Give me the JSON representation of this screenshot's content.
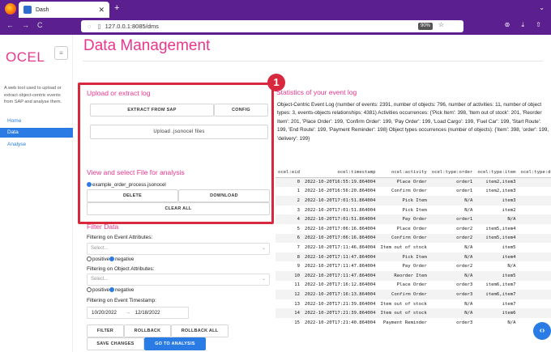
{
  "browser": {
    "tab_title": "Dash",
    "tab_close": "✕",
    "new_tab": "+",
    "tab_list": "⌄",
    "url": "127.0.0.1:8085/dms",
    "zoom": "90%",
    "back": "←",
    "forward": "→",
    "reload": "C",
    "toolbar_icons": "⊚ ⤓ ⇧"
  },
  "sidebar": {
    "brand": "OCEL",
    "menu_icon": "≡",
    "description": "A web tool used to upload or extract object-centric events from SAP and analyse them.",
    "items": [
      {
        "label": "Home"
      },
      {
        "label": "Data"
      },
      {
        "label": "Analyse"
      }
    ]
  },
  "main": {
    "title": "Data Management",
    "upload": {
      "title": "Upload or extract log",
      "extract_btn": "EXTRACT FROM SAP",
      "config_btn": "CONFIG",
      "upload_btn": "Upload .jsonocel files"
    },
    "view": {
      "title": "View and select File for analysis",
      "file": "example_order_process.jsonocel",
      "delete_btn": "DELETE",
      "download_btn": "DOWNLOAD",
      "clear_btn": "CLEAR ALL"
    },
    "annotation_number": "1",
    "filter": {
      "title": "Filter Data",
      "event_attr_label": "Filtering on Event Attributes:",
      "event_attr_placeholder": "Select...",
      "object_attr_label": "Filtering on Object Attributes:",
      "object_attr_placeholder": "Select...",
      "positive": "positive",
      "negative": "negative",
      "timestamp_label": "Filtering on Event Timestamp:",
      "date_from": "10/20/2022",
      "date_arrow": "→",
      "date_to": "12/18/2022",
      "filter_btn": "FILTER",
      "rollback_btn": "ROLLBACK",
      "rollback_all_btn": "ROLLBACK ALL",
      "save_btn": "SAVE CHANGES",
      "goto_btn": "GO TO ANALYSIS"
    },
    "stats": {
      "title": "Statistics of your event log",
      "text": "Object-Centric Event Log (number of events: 2391, number of objects: 796, number of activities: 11, number of object types: 3, events-objects relationships: 4381) Activities occurrences: {'Pick Item': 398, 'Item out of stock': 201, 'Reorder Item': 201, 'Place Order': 199, 'Confirm Order': 199, 'Pay Order': 199, 'Load Cargo': 199, 'Fuel Car': 199, 'Start Route': 199, 'End Route': 199, 'Payment Reminder': 198} Object types occurrences (number of objects): {'item': 398, 'order': 199, 'delivery': 199}"
    },
    "table": {
      "headers": [
        "ocel:eid",
        "ocel:timestamp",
        "ocel:activity",
        "ocel:type:order",
        "ocel:type:item",
        "ocel:type:delivery"
      ],
      "rows": [
        [
          "0",
          "2022-10-20T16:55:19.864004",
          "Place Order",
          "order1",
          "item2,item3",
          "N/"
        ],
        [
          "1",
          "2022-10-20T16:56:20.864004",
          "Confirm Order",
          "order1",
          "item2,item3",
          "N/"
        ],
        [
          "2",
          "2022-10-20T17:01:51.864004",
          "Pick Item",
          "N/A",
          "item3",
          "N/"
        ],
        [
          "3",
          "2022-10-20T17:01:51.864004",
          "Pick Item",
          "N/A",
          "item2",
          "N/"
        ],
        [
          "4",
          "2022-10-20T17:01:51.864004",
          "Pay Order",
          "order1",
          "N/A",
          "N/"
        ],
        [
          "5",
          "2022-10-20T17:06:16.864004",
          "Place Order",
          "order2",
          "item5,item4",
          "N/"
        ],
        [
          "6",
          "2022-10-20T17:06:16.864004",
          "Confirm Order",
          "order2",
          "item5,item4",
          "N/"
        ],
        [
          "7",
          "2022-10-20T17:11:46.864004",
          "Item out of stock",
          "N/A",
          "item5",
          "N/"
        ],
        [
          "8",
          "2022-10-20T17:11:47.864004",
          "Pick Item",
          "N/A",
          "item4",
          "N/"
        ],
        [
          "9",
          "2022-10-20T17:11:47.864004",
          "Pay Order",
          "order2",
          "N/A",
          "N/"
        ],
        [
          "10",
          "2022-10-20T17:11:47.864004",
          "Reorder Item",
          "N/A",
          "item5",
          "N/"
        ],
        [
          "11",
          "2022-10-20T17:16:12.864004",
          "Place Order",
          "order3",
          "item6,item7",
          "N/"
        ],
        [
          "12",
          "2022-10-20T17:16:13.864004",
          "Confirm Order",
          "order3",
          "item6,item7",
          "N/"
        ],
        [
          "13",
          "2022-10-20T17:21:39.864004",
          "Item out of stock",
          "N/A",
          "item7",
          "N/"
        ],
        [
          "14",
          "2022-10-20T17:21:39.864004",
          "Item out of stock",
          "N/A",
          "item6",
          "N/"
        ],
        [
          "15",
          "2022-10-20T17:21:40.864004",
          "Payment Reminder",
          "order3",
          "N/A",
          "N/"
        ]
      ]
    },
    "scroll_icon": "‹›"
  },
  "colors": {
    "accent": "#e8378c",
    "primary": "#2a7be4",
    "annotation": "#d8283d",
    "chrome": "#5b1f8f"
  }
}
